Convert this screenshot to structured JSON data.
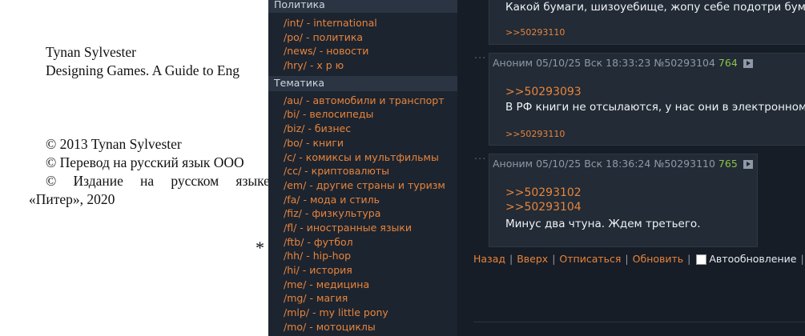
{
  "book": {
    "author_name": "Tynan Sylvester",
    "book_title": "Designing Games. A Guide to Eng",
    "copyright_1": "© 2013 Tynan Sylvester",
    "copyright_2": "© Перевод на русский язык ООО",
    "copyright_3_words": [
      "©",
      "Издание",
      "на",
      "русском",
      "языке"
    ],
    "copyright_3_cont": "«Питер», 2020",
    "asterisk": "*"
  },
  "sidebar": {
    "section_politics": "Политика",
    "politics_boards": [
      {
        "code": "/int/",
        "name": "international"
      },
      {
        "code": "/po/",
        "name": "политика"
      },
      {
        "code": "/news/",
        "name": "новости"
      },
      {
        "code": "/hry/",
        "name": "х р ю"
      }
    ],
    "section_topics": "Тематика",
    "topic_boards": [
      {
        "code": "/au/",
        "name": "автомобили и транспорт"
      },
      {
        "code": "/bi/",
        "name": "велосипеды"
      },
      {
        "code": "/biz/",
        "name": "бизнес"
      },
      {
        "code": "/bo/",
        "name": "книги"
      },
      {
        "code": "/c/",
        "name": "комиксы и мультфильмы"
      },
      {
        "code": "/cc/",
        "name": "криптовалюты"
      },
      {
        "code": "/em/",
        "name": "другие страны и туризм"
      },
      {
        "code": "/fa/",
        "name": "мода и стиль"
      },
      {
        "code": "/fiz/",
        "name": "физкультура"
      },
      {
        "code": "/fl/",
        "name": "иностранные языки"
      },
      {
        "code": "/ftb/",
        "name": "футбол"
      },
      {
        "code": "/hh/",
        "name": "hip-hop"
      },
      {
        "code": "/hi/",
        "name": "история"
      },
      {
        "code": "/me/",
        "name": "медицина"
      },
      {
        "code": "/mg/",
        "name": "магия"
      },
      {
        "code": "/mlp/",
        "name": "my little pony"
      },
      {
        "code": "/mo/",
        "name": "мотоциклы"
      }
    ],
    "separator": " - "
  },
  "posts": [
    {
      "text": "Какой бумаги, шизоуебище, жопу себе подотри бума",
      "reply_small": ">>50293110"
    },
    {
      "dots": "···",
      "author": "Аноним",
      "date": "05/10/25 Вск 18:33:23",
      "num": "№50293104",
      "count": "764",
      "quote": ">>50293093",
      "text": "В РФ книги не отсылаются, у нас они в электронном с",
      "reply_small": ">>50293110"
    },
    {
      "dots": "···",
      "author": "Аноним",
      "date": "05/10/25 Вск 18:36:24",
      "num": "№50293110",
      "count": "765",
      "quote1": ">>50293102",
      "quote2": ">>50293104",
      "text": "Минус два чтуна. Ждем третьего."
    }
  ],
  "footer": {
    "back": "Назад",
    "top": "Вверх",
    "unsubscribe": "Отписаться",
    "refresh": "Обновить",
    "auto_refresh": "Автообновление",
    "bar": "|"
  }
}
